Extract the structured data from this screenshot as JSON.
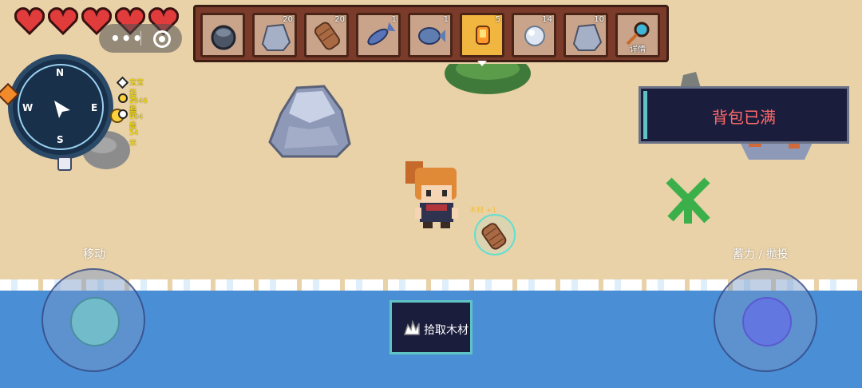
{
  "hud": {
    "hearts": 5,
    "menu_capsule": {
      "dots_icon": "more-dots-icon",
      "close_icon": "target-circle-icon"
    }
  },
  "hotbar": {
    "slots": [
      {
        "icon": "dark-stone-icon",
        "count": ""
      },
      {
        "icon": "stone-icon",
        "count": "20"
      },
      {
        "icon": "wood-log-icon",
        "count": "20"
      },
      {
        "icon": "blue-fish-icon",
        "count": "1"
      },
      {
        "icon": "round-fish-icon",
        "count": "1"
      },
      {
        "icon": "torch-icon",
        "count": "5",
        "selected": true
      },
      {
        "icon": "pearl-icon",
        "count": "14"
      },
      {
        "icon": "stone-icon",
        "count": "10"
      },
      {
        "icon": "magnifier-key-icon",
        "count": "",
        "label": "详情"
      }
    ]
  },
  "compass": {
    "n": "N",
    "s": "S",
    "e": "E",
    "w": "W"
  },
  "waypoints": [
    {
      "text": "宝宝箱2346米"
    },
    {
      "text": "宝箱104米"
    },
    {
      "text": "商店54米"
    }
  ],
  "notice": {
    "text": "背包已满"
  },
  "controls": {
    "move_label": "移动",
    "charge_label": "蓄力 / 抛投",
    "pickup_label": "拾取木材"
  },
  "world": {
    "drop_tag": "木材 +1"
  },
  "colors": {
    "sea": "#4a8fd6",
    "sand": "#e9d1a8",
    "notice_text": "#ff6a6a",
    "hotbar": "#7a3b2a"
  }
}
